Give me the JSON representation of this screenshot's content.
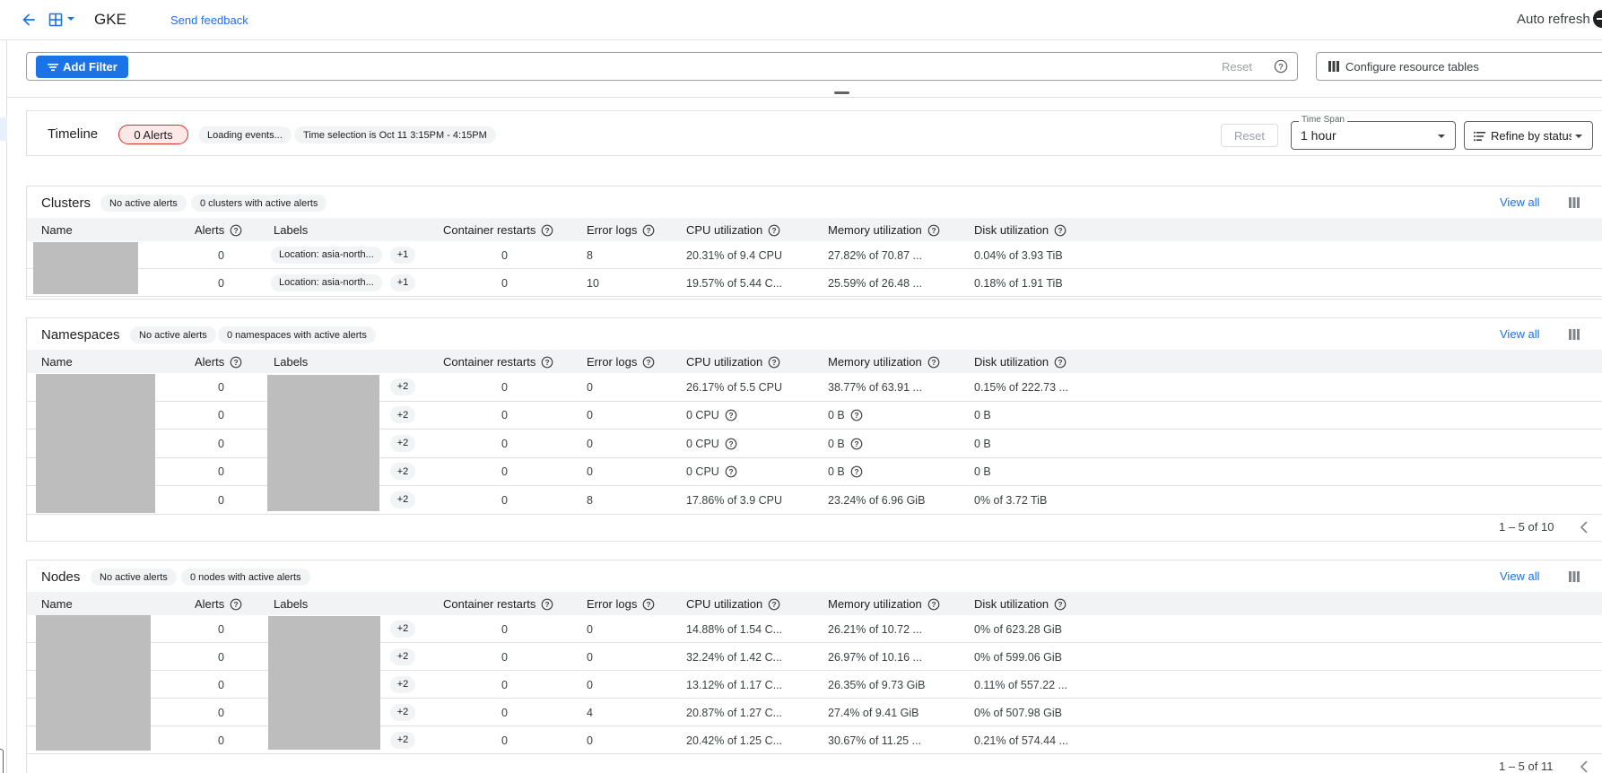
{
  "topbar": {
    "title": "GKE",
    "feedback": "Send feedback",
    "auto_refresh": "Auto refresh"
  },
  "filterbar": {
    "add_filter": "Add Filter",
    "reset": "Reset",
    "configure": "Configure resource tables"
  },
  "timeline": {
    "title": "Timeline",
    "alerts": "0 Alerts",
    "loading": "Loading events...",
    "selection": "Time selection is Oct 11 3:15PM - 4:15PM",
    "reset": "Reset",
    "timespan_label": "Time Span",
    "timespan_value": "1 hour",
    "refine": "Refine by status"
  },
  "columns": [
    "Name",
    "Alerts",
    "Labels",
    "Container restarts",
    "Error logs",
    "CPU utilization",
    "Memory utilization",
    "Disk utilization"
  ],
  "view_all": "View all",
  "clusters": {
    "title": "Clusters",
    "chip_alerts": "No active alerts",
    "chip_count": "0 clusters with active alerts",
    "rows": [
      {
        "alerts": "0",
        "label": "Location: asia-north...",
        "more": "+1",
        "restarts": "0",
        "errors": "8",
        "cpu": "20.31% of 9.4 CPU",
        "memory": "27.82% of 70.87 ...",
        "disk": "0.04% of 3.93 TiB"
      },
      {
        "alerts": "0",
        "label": "Location: asia-north...",
        "more": "+1",
        "restarts": "0",
        "errors": "10",
        "cpu": "19.57% of 5.44 C...",
        "memory": "25.59% of 26.48 ...",
        "disk": "0.18% of 1.91 TiB"
      }
    ]
  },
  "namespaces": {
    "title": "Namespaces",
    "chip_alerts": "No active alerts",
    "chip_count": "0 namespaces with active alerts",
    "pagination": "1 – 5 of 10",
    "rows": [
      {
        "alerts": "0",
        "more": "+2",
        "restarts": "0",
        "errors": "0",
        "cpu": "26.17% of 5.5 CPU",
        "memory": "38.77% of 63.91 ...",
        "disk": "0.15% of 222.73 ..."
      },
      {
        "alerts": "0",
        "more": "+2",
        "restarts": "0",
        "errors": "0",
        "cpu": "0 CPU",
        "memory": "0 B",
        "disk": "0 B"
      },
      {
        "alerts": "0",
        "more": "+2",
        "restarts": "0",
        "errors": "0",
        "cpu": "0 CPU",
        "memory": "0 B",
        "disk": "0 B"
      },
      {
        "alerts": "0",
        "more": "+2",
        "restarts": "0",
        "errors": "0",
        "cpu": "0 CPU",
        "memory": "0 B",
        "disk": "0 B"
      },
      {
        "alerts": "0",
        "more": "+2",
        "restarts": "0",
        "errors": "8",
        "cpu": "17.86% of 3.9 CPU",
        "memory": "23.24% of 6.96 GiB",
        "disk": "0% of 3.72 TiB"
      }
    ]
  },
  "nodes": {
    "title": "Nodes",
    "chip_alerts": "No active alerts",
    "chip_count": "0 nodes with active alerts",
    "pagination": "1 – 5 of 11",
    "rows": [
      {
        "alerts": "0",
        "more": "+2",
        "restarts": "0",
        "errors": "0",
        "cpu": "14.88% of 1.54 C...",
        "memory": "26.21% of 10.72 ...",
        "disk": "0% of 623.28 GiB"
      },
      {
        "alerts": "0",
        "more": "+2",
        "restarts": "0",
        "errors": "0",
        "cpu": "32.24% of 1.42 C...",
        "memory": "26.97% of 10.16 ...",
        "disk": "0% of 599.06 GiB"
      },
      {
        "alerts": "0",
        "more": "+2",
        "restarts": "0",
        "errors": "0",
        "cpu": "13.12% of 1.17 C...",
        "memory": "26.35% of 9.73 GiB",
        "disk": "0.11% of 557.22 ..."
      },
      {
        "alerts": "0",
        "more": "+2",
        "restarts": "0",
        "errors": "4",
        "cpu": "20.87% of 1.27 C...",
        "memory": "27.4% of 9.41 GiB",
        "disk": "0% of 507.98 GiB"
      },
      {
        "alerts": "0",
        "more": "+2",
        "restarts": "0",
        "errors": "0",
        "cpu": "20.42% of 1.25 C...",
        "memory": "30.67% of 11.25 ...",
        "disk": "0.21% of 574.44 ..."
      }
    ]
  }
}
